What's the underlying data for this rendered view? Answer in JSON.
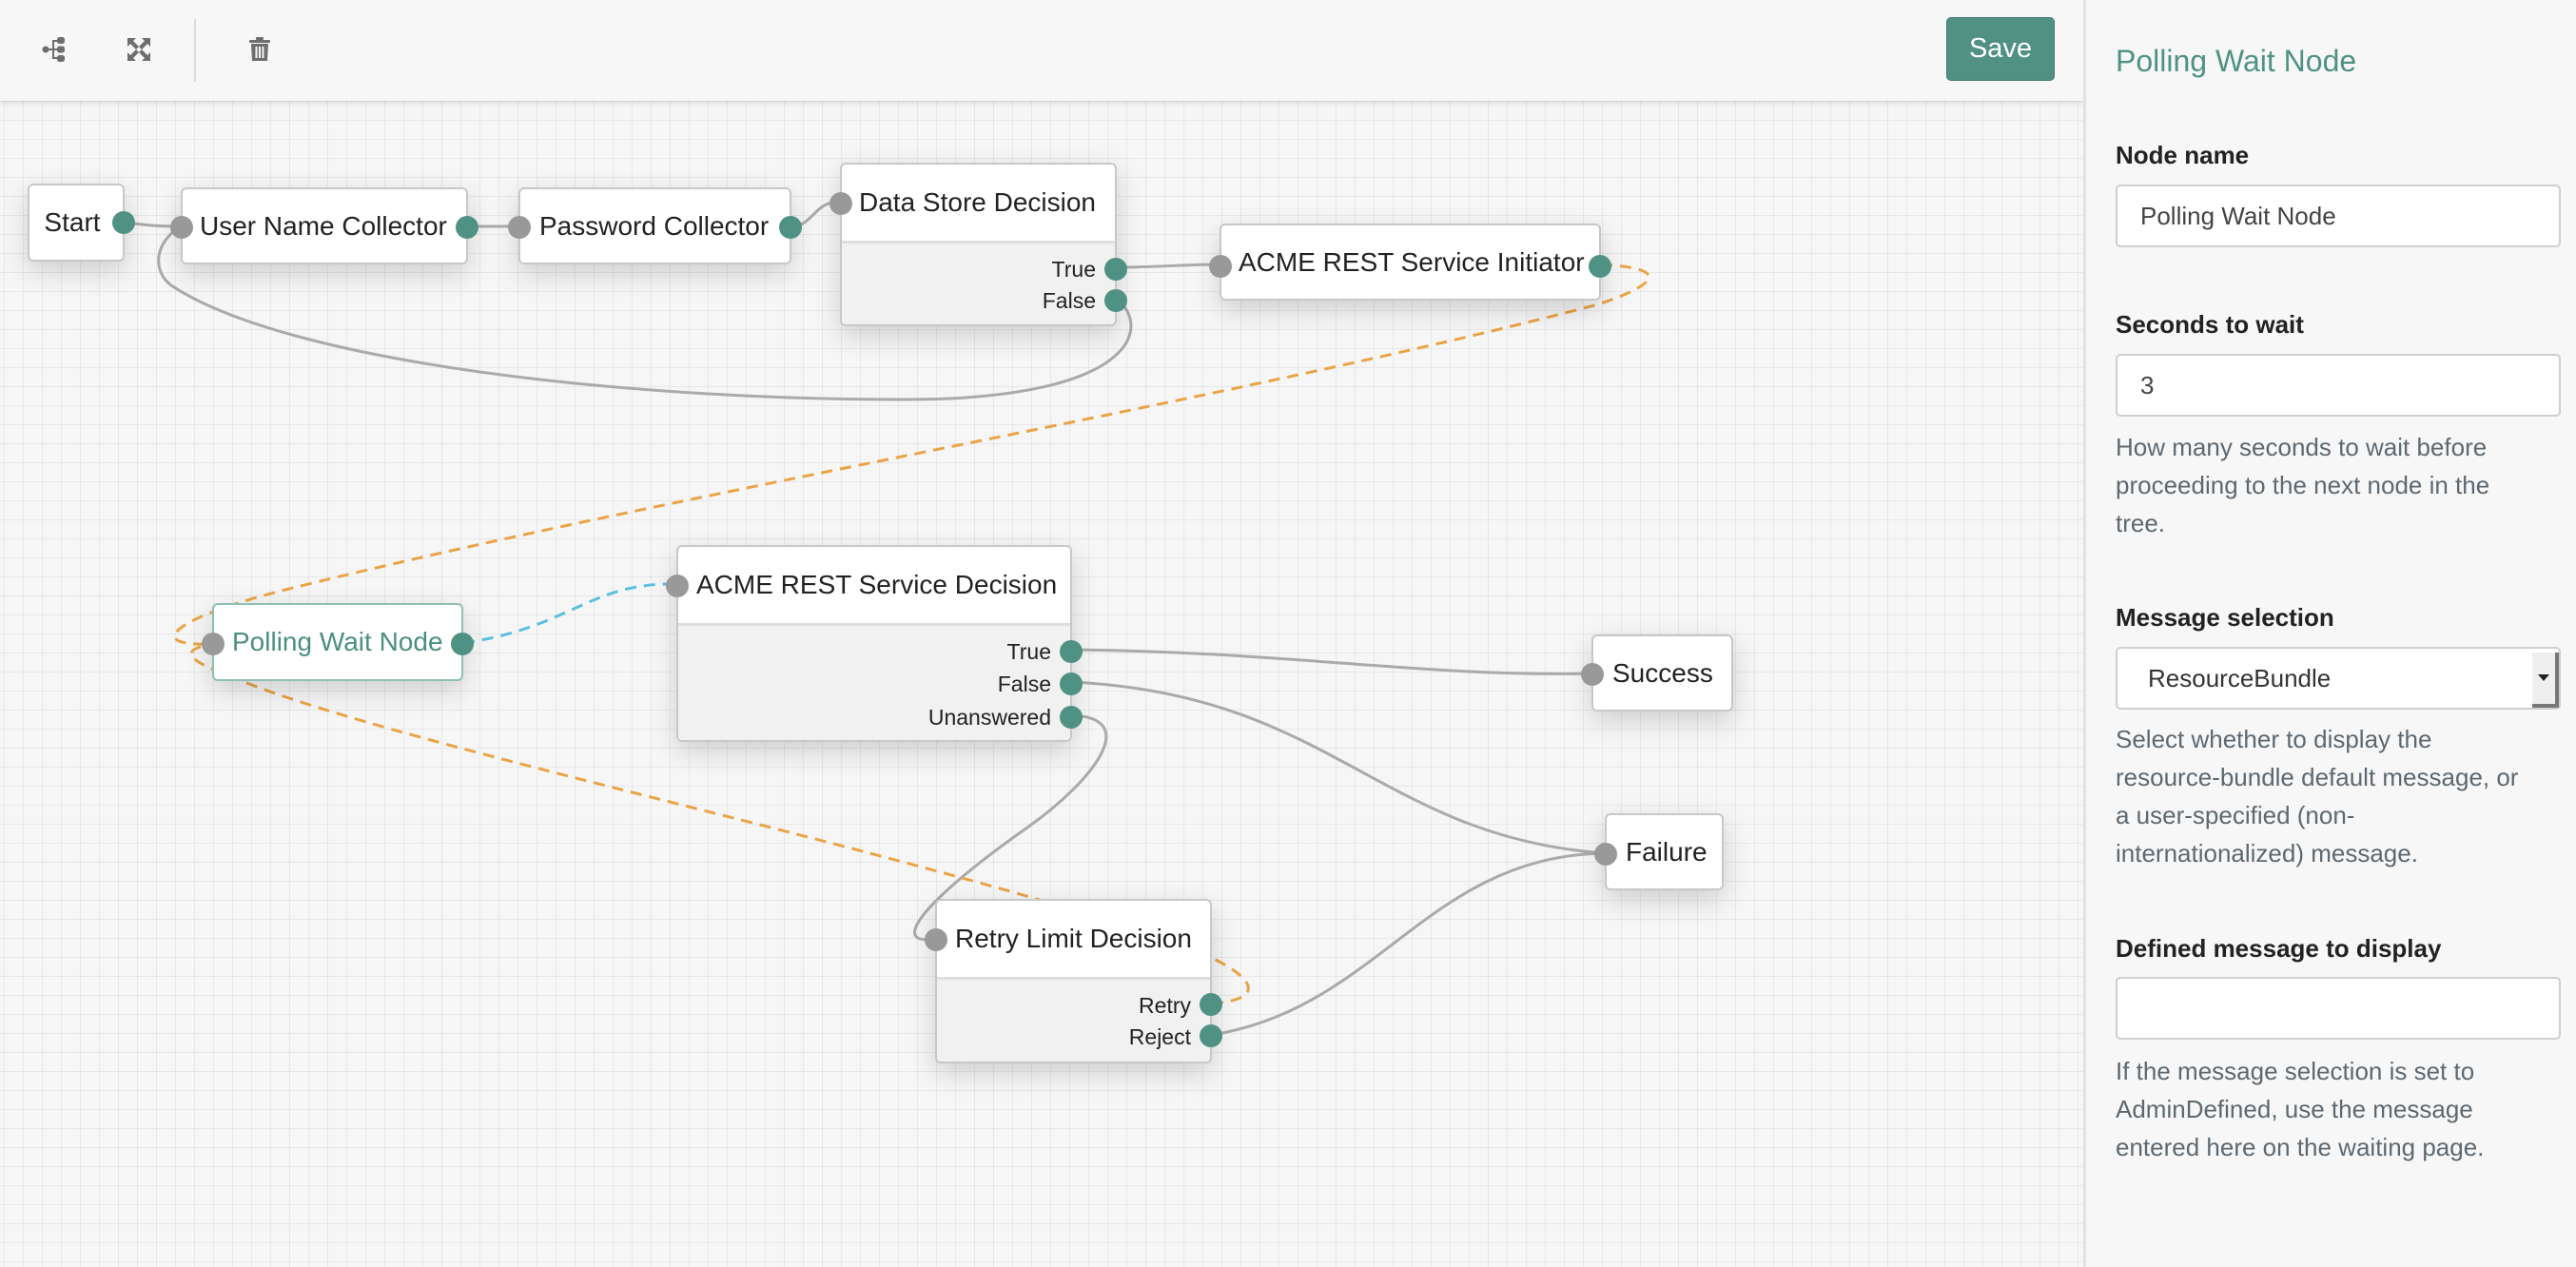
{
  "toolbar": {
    "icons": [
      "tree-layout-icon",
      "fullscreen-icon",
      "trash-icon"
    ],
    "save_label": "Save"
  },
  "colors": {
    "accent": "#519184",
    "port_out": "#4f9284",
    "port_in": "#999999",
    "link_solid": "#aaaaaa",
    "link_retry_dashed": "#eaa447",
    "link_selected_dashed": "#5bc0de"
  },
  "nodes": {
    "start": {
      "title": "Start"
    },
    "username": {
      "title": "User Name Collector"
    },
    "password": {
      "title": "Password Collector"
    },
    "datastore": {
      "title": "Data Store Decision",
      "outcomes": [
        "True",
        "False"
      ]
    },
    "initiator": {
      "title": "ACME REST Service Initiator"
    },
    "polling": {
      "title": "Polling Wait Node",
      "selected": true
    },
    "acme_decision": {
      "title": "ACME REST Service Decision",
      "outcomes": [
        "True",
        "False",
        "Unanswered"
      ]
    },
    "success": {
      "title": "Success"
    },
    "failure": {
      "title": "Failure"
    },
    "retry": {
      "title": "Retry Limit Decision",
      "outcomes": [
        "Retry",
        "Reject"
      ]
    }
  },
  "panel": {
    "title": "Polling Wait Node",
    "fields": {
      "node_name": {
        "label": "Node name",
        "value": "Polling Wait Node"
      },
      "seconds": {
        "label": "Seconds to wait",
        "value": "3",
        "help": "How many seconds to wait before proceeding to the next node in the tree."
      },
      "message_selection": {
        "label": "Message selection",
        "value": "ResourceBundle",
        "help": "Select whether to display the resource-bundle default message, or a user-specified (non-internationalized) message."
      },
      "defined_message": {
        "label": "Defined message to display",
        "value": "",
        "help": "If the message selection is set to AdminDefined, use the message entered here on the waiting page."
      }
    }
  }
}
